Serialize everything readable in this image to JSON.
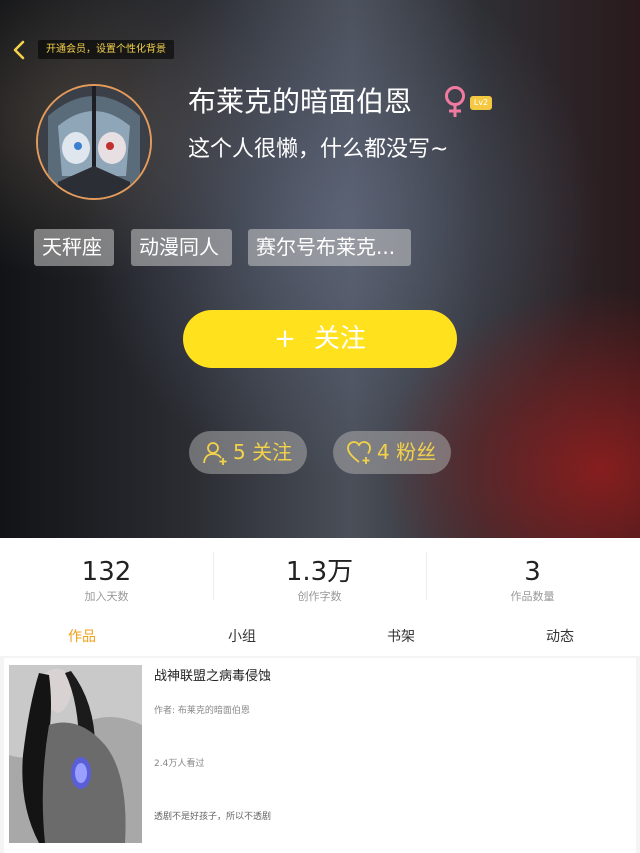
{
  "header": {
    "vip_banner": "开通会员，设置个性化背景"
  },
  "profile": {
    "username": "布莱克的暗面伯恩",
    "gender_symbol": "♀",
    "level": "Lv2",
    "bio": "这个人很懒，什么都没写~",
    "tags": [
      "天秤座",
      "动漫同人",
      "赛尔号布莱克..."
    ],
    "follow_button": {
      "plus": "+",
      "label": "关注"
    },
    "following": "5 关注",
    "fans": "4 粉丝"
  },
  "stats": [
    {
      "value": "132",
      "label": "加入天数"
    },
    {
      "value": "1.3万",
      "label": "创作字数"
    },
    {
      "value": "3",
      "label": "作品数量"
    }
  ],
  "tabs": [
    {
      "label": "作品",
      "active": true
    },
    {
      "label": "小组",
      "active": false
    },
    {
      "label": "书架",
      "active": false
    },
    {
      "label": "动态",
      "active": false
    }
  ],
  "works": [
    {
      "title": "战神联盟之病毒侵蚀",
      "author": "作者: 布莱克的暗面伯恩",
      "views": "2.4万人看过",
      "description": "透剧不是好孩子，所以不透剧"
    }
  ],
  "colors": {
    "accent_yellow": "#ffe11e",
    "active_tab": "#f0a11a",
    "gender_pink": "#f27aa0"
  }
}
